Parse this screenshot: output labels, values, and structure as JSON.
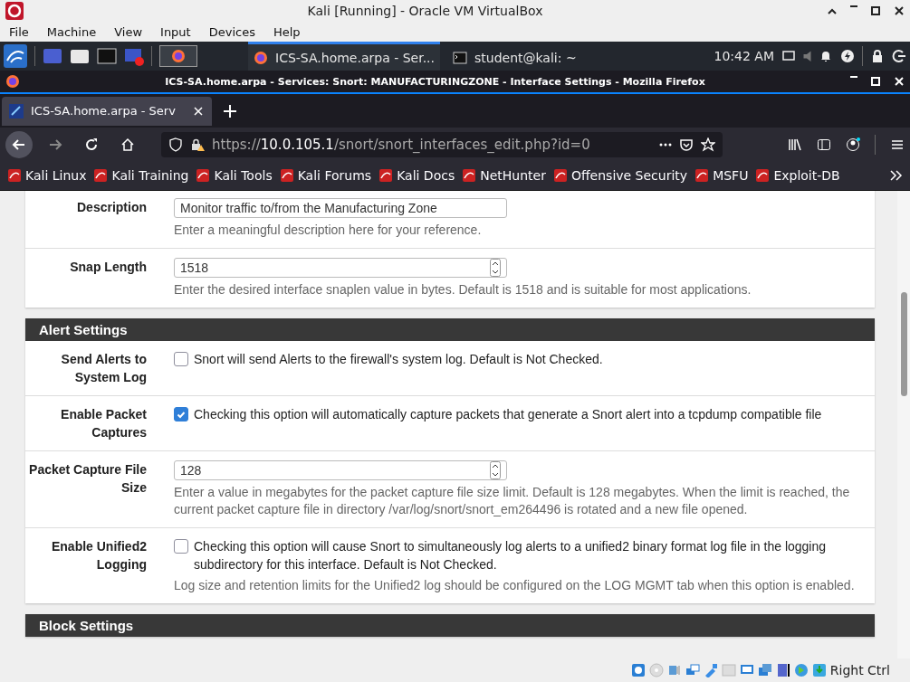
{
  "window": {
    "title": "Kali [Running] - Oracle VM VirtualBox"
  },
  "menu": [
    "File",
    "Machine",
    "View",
    "Input",
    "Devices",
    "Help"
  ],
  "taskbar": {
    "tasks": [
      {
        "label": "ICS-SA.home.arpa - Ser...",
        "kind": "browser",
        "selected": true
      },
      {
        "label": "student@kali: ~",
        "kind": "terminal",
        "selected": false
      }
    ],
    "clock": "10:42 AM"
  },
  "browser": {
    "title": "ICS-SA.home.arpa - Services: Snort: MANUFACTURINGZONE - Interface Settings - Mozilla Firefox",
    "tabs": [
      {
        "label": "ICS-SA.home.arpa - Serv",
        "selected": true
      }
    ],
    "url": {
      "prefix": "https://",
      "host": "10.0.105.1",
      "path": "/snort/snort_interfaces_edit.php?id=0"
    },
    "bookmarks": [
      "Kali Linux",
      "Kali Training",
      "Kali Tools",
      "Kali Forums",
      "Kali Docs",
      "NetHunter",
      "Offensive Security",
      "MSFU",
      "Exploit-DB"
    ]
  },
  "sections": [
    {
      "rows": [
        {
          "kind": "text",
          "label": "Description",
          "value": "Monitor traffic to/from the Manufacturing Zone",
          "help": "Enter a meaningful description here for your reference."
        },
        {
          "kind": "number",
          "label": "Snap Length",
          "value": "1518",
          "help": "Enter the desired interface snaplen value in bytes. Default is 1518 and is suitable for most applications."
        }
      ]
    },
    {
      "title": "Alert Settings",
      "rows": [
        {
          "kind": "checkbox",
          "label": "Send Alerts to System Log",
          "checked": false,
          "text": "Snort will send Alerts to the firewall's system log. Default is Not Checked."
        },
        {
          "kind": "checkbox",
          "label": "Enable Packet Captures",
          "checked": true,
          "text": "Checking this option will automatically capture packets that generate a Snort alert into a tcpdump compatible file"
        },
        {
          "kind": "number",
          "label": "Packet Capture File Size",
          "value": "128",
          "help": "Enter a value in megabytes for the packet capture file size limit. Default is 128 megabytes. When the limit is reached, the current packet capture file in directory /var/log/snort/snort_em264496 is rotated and a new file opened."
        },
        {
          "kind": "checkbox",
          "label": "Enable Unified2 Logging",
          "checked": false,
          "text": "Checking this option will cause Snort to simultaneously log alerts to a unified2 binary format log file in the logging subdirectory for this interface. Default is Not Checked.",
          "note": "Log size and retention limits for the Unified2 log should be configured on the LOG MGMT tab when this option is enabled."
        }
      ]
    },
    {
      "title": "Block Settings"
    }
  ],
  "status_bar": {
    "host_key": "Right Ctrl"
  }
}
